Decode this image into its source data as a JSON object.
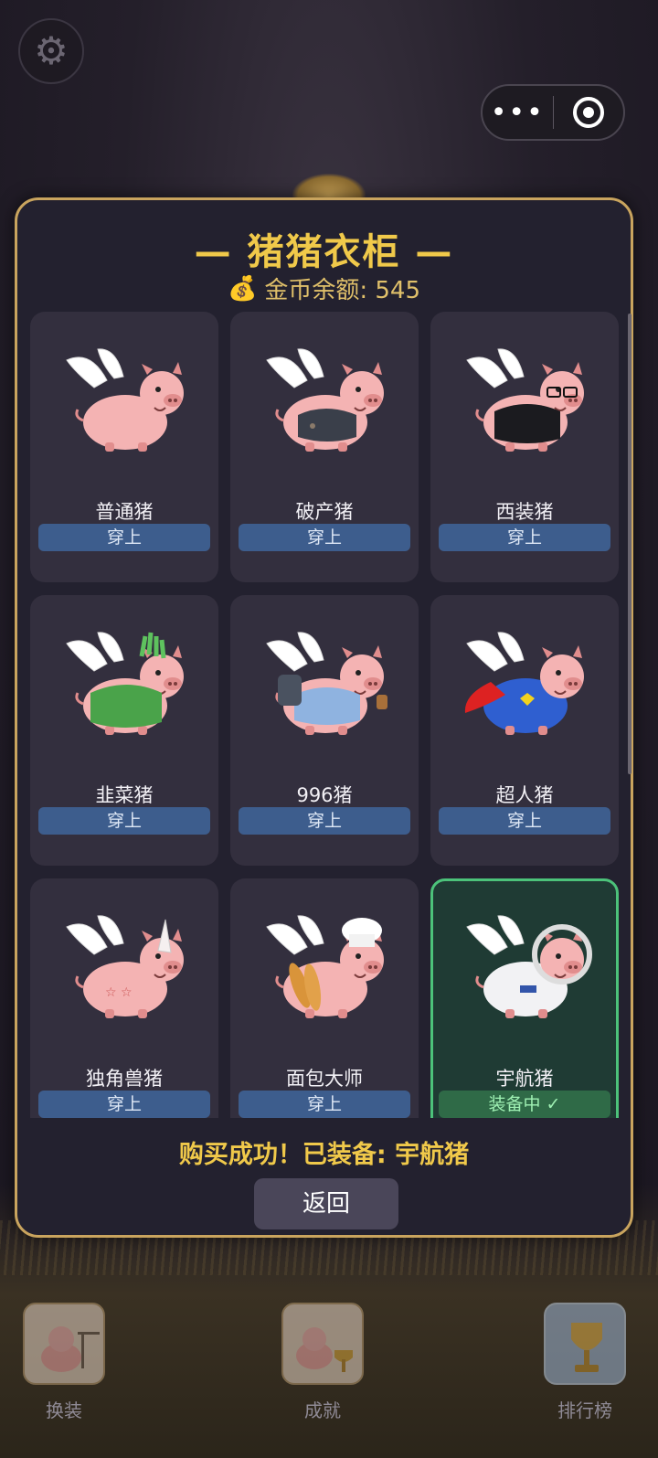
{
  "topbar": {
    "settings_icon": "gear-icon",
    "capsule_more": "•••",
    "capsule_close_icon": "target-icon"
  },
  "wardrobe": {
    "title": "— 猪猪衣柜 —",
    "balance_label": "金币余额: 545",
    "balance_icon": "money-bag-icon",
    "items": [
      {
        "name": "普通猪",
        "button": "穿上",
        "equipped": false,
        "outfit": "plain"
      },
      {
        "name": "破产猪",
        "button": "穿上",
        "equipped": false,
        "outfit": "ragged-suit"
      },
      {
        "name": "西装猪",
        "button": "穿上",
        "equipped": false,
        "outfit": "suit-glasses"
      },
      {
        "name": "韭菜猪",
        "button": "穿上",
        "equipped": false,
        "outfit": "green-leek"
      },
      {
        "name": "996猪",
        "button": "穿上",
        "equipped": false,
        "outfit": "backpack-shirt"
      },
      {
        "name": "超人猪",
        "button": "穿上",
        "equipped": false,
        "outfit": "superhero"
      },
      {
        "name": "独角兽猪",
        "button": "穿上",
        "equipped": false,
        "outfit": "unicorn"
      },
      {
        "name": "面包大师",
        "button": "穿上",
        "equipped": false,
        "outfit": "chef-baguette"
      },
      {
        "name": "宇航猪",
        "button": "装备中 ✓",
        "equipped": true,
        "outfit": "astronaut"
      }
    ],
    "status": "购买成功！已装备: 宇航猪",
    "back_label": "返回"
  },
  "bottom_nav": [
    {
      "label": "换装",
      "icon": "wardrobe-icon"
    },
    {
      "label": "成就",
      "icon": "trophy-pig-icon"
    },
    {
      "label": "排行榜",
      "icon": "trophy-icon"
    }
  ],
  "colors": {
    "accent_gold": "#f0c94a",
    "panel_bg": "#23212f",
    "card_bg": "#332f3e",
    "button_blue": "#3d5d8d",
    "equipped_green": "#4cc27a"
  }
}
